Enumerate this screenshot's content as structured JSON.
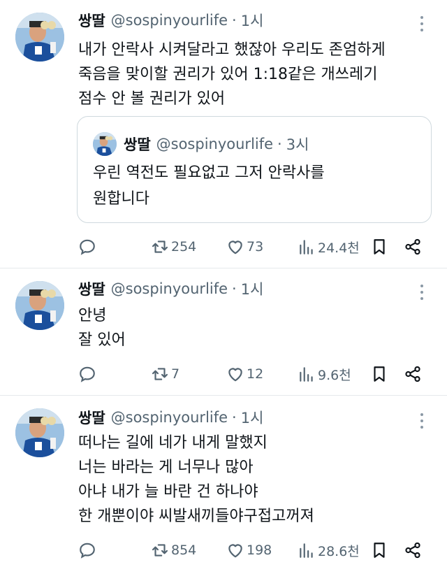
{
  "tweets": [
    {
      "name": "쌍딸",
      "handle": "@sospinyourlife",
      "dot": "·",
      "time": "1시",
      "lines": [
        "내가 안락사 시켜달라고 했잖아 우리도 존엄하게",
        "죽음을 맞이할 권리가 있어 1:18같은 개쓰레기",
        "점수 안 볼 권리가 있어"
      ],
      "quote": {
        "name": "쌍딸",
        "handle": "@sospinyourlife",
        "dot": "·",
        "time": "3시",
        "lines": [
          "우린 역전도 필요없고 그저 안락사를",
          "원합니다"
        ]
      },
      "retweets": "254",
      "likes": "73",
      "views": "24.4천"
    },
    {
      "name": "쌍딸",
      "handle": "@sospinyourlife",
      "dot": "·",
      "time": "1시",
      "lines": [
        "안녕",
        "잘 있어"
      ],
      "retweets": "7",
      "likes": "12",
      "views": "9.6천"
    },
    {
      "name": "쌍딸",
      "handle": "@sospinyourlife",
      "dot": "·",
      "time": "1시",
      "lines": [
        "떠나는 길에 네가 내게 말했지",
        "너는 바라는 게 너무나 많아",
        "아냐 내가 늘 바란 건 하나야",
        "한 개뿐이야 씨발새끼들야구접고꺼져"
      ],
      "retweets": "854",
      "likes": "198",
      "views": "28.6천"
    }
  ],
  "icons": {
    "reply": "reply-icon",
    "retweet": "retweet-icon",
    "like": "heart-icon",
    "views": "views-icon",
    "bookmark": "bookmark-icon",
    "share": "share-icon",
    "more": "more-icon"
  },
  "colors": {
    "text": "#0f1419",
    "secondary": "#536471",
    "divider": "#e6e9ec",
    "quote_border": "#cfd9de"
  }
}
